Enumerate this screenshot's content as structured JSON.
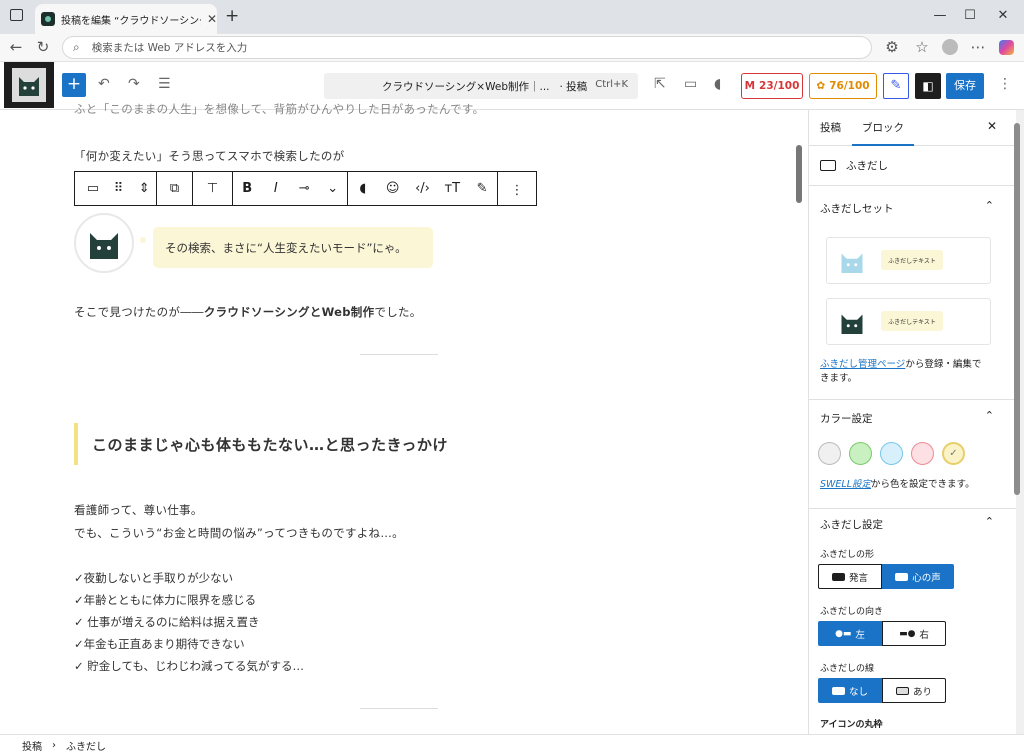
{
  "browser": {
    "tab_title": "投稿を編集 “クラウドソーシング×Web",
    "address_placeholder": "検索または Web アドレスを入力"
  },
  "wp_header": {
    "document_title": "クラウドソーシング×Web制作｜...",
    "document_type": "· 投稿",
    "shortcut": "Ctrl+K",
    "score_red": "23/100",
    "score_orange": "76/100",
    "save_label": "保存"
  },
  "editor": {
    "line_top": "ふと「このままの人生」を想像して、背筋がひんやりした日があったんです。",
    "line_search": "「何か変えたい」そう思ってスマホで検索したのが",
    "bubble_text": "その検索、まさに“人生変えたいモード”にゃ。",
    "found_prefix": "そこで見つけたのが――",
    "found_bold": "クラウドソーシングとWeb制作",
    "found_suffix": "でした。",
    "heading": "このままじゃ心も体ももたない…と思ったきっかけ",
    "para1": "看護師って、尊い仕事。",
    "para2": "でも、こういう“お金と時間の悩み”ってつきものですよね…。",
    "checks": [
      "✓夜勤しないと手取りが少ない",
      "✓年齢とともに体力に限界を感じる",
      "✓ 仕事が増えるのに給料は据え置き",
      "✓年金も正直あまり期待できない",
      "✓ 貯金しても、じわじわ減ってる気がする…"
    ]
  },
  "sidebar": {
    "tab_post": "投稿",
    "tab_block": "ブロック",
    "block_name": "ふきだし",
    "set_title": "ふきだしセット",
    "preset_text": "ふきだしテキスト",
    "manage_link": "ふきだし管理ページ",
    "manage_suffix": "から登録・編集で",
    "manage_suffix2": "きます。",
    "color_title": "カラー設定",
    "swell_link": "SWELL設定",
    "swell_suffix": "から色を設定できます。",
    "bubble_settings": "ふきだし設定",
    "shape_label": "ふきだしの形",
    "shape_speech": "発言",
    "shape_thought": "心の声",
    "dir_label": "ふきだしの向き",
    "dir_left": "左",
    "dir_right": "右",
    "line_label": "ふきだしの線",
    "line_none": "なし",
    "line_yes": "あり",
    "icon_round": "アイコンの丸枠"
  },
  "colors": {
    "accent": "#1a73c6",
    "bubble_bg": "#fbf6d5",
    "swatches": [
      "#f0f0f0",
      "#c8f0c0",
      "#d8f0fb",
      "#fde0e4",
      "#fbf3c8"
    ]
  },
  "status": {
    "crumb1": "投稿",
    "crumb2": "ふきだし"
  }
}
